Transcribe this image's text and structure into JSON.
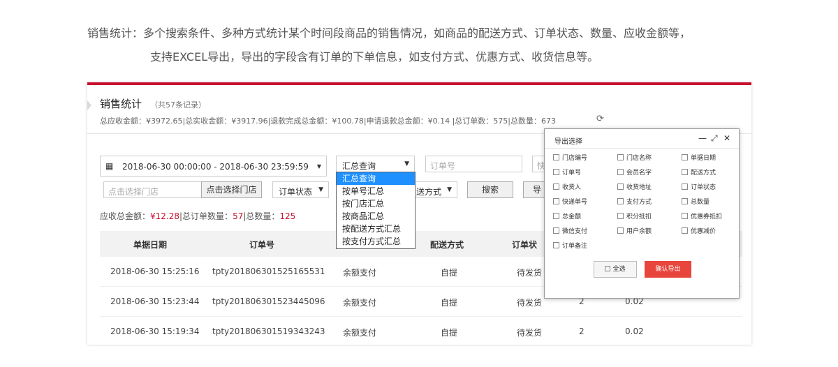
{
  "intro": {
    "line1": "销售统计：多个搜索条件、多种方式统计某个时间段商品的销售情况，如商品的配送方式、订单状态、数量、应收金额等，",
    "line2": "支持EXCEL导出，导出的字段含有订单的下单信息，如支付方式、优惠方式、收货信息等。"
  },
  "page": {
    "title": "销售统计",
    "record_count": "（共57条记录）",
    "summary": "总应收金额：¥3972.65|总实收金额：¥3917.96|退款完成总金额：¥100.78|申请退款总金额：¥0.14 |总订单数：575|总数量：673",
    "refresh_icon": "refresh-icon"
  },
  "filters": {
    "date_range": "2018-06-30 00:00:00 - 2018-06-30 23:59:59",
    "query_mode_value": "汇总查询",
    "order_no_placeholder": "订单号",
    "fast_placeholder": "快",
    "store_placeholder": "点击选择门店",
    "store_button": "点击选择门店",
    "order_status": "订单状态",
    "delivery_partial": "送方式",
    "search_button": "搜索",
    "export_partial": "导"
  },
  "query_modes": [
    "汇总查询",
    "按单号汇总",
    "按门店汇总",
    "按商品汇总",
    "按配送方式汇总",
    "按支付方式汇总"
  ],
  "totals": {
    "receivable_label": "应收总金额：",
    "receivable_value": "¥12.28",
    "orders_label": "|总订单数量：",
    "orders_value": "57",
    "qty_label": "|总数量：",
    "qty_value": "125"
  },
  "table": {
    "columns": [
      "单据日期",
      "订单号",
      "",
      "配送方式",
      "订单状"
    ],
    "rows": [
      {
        "date": "2018-06-30 15:25:16",
        "order": "tpty201806301525165531",
        "pay": "余额支付",
        "delivery": "自提",
        "status": "待发货",
        "qty": "",
        "amount": ""
      },
      {
        "date": "2018-06-30 15:23:44",
        "order": "tpty201806301523445096",
        "pay": "余额支付",
        "delivery": "自提",
        "status": "待发货",
        "qty": "2",
        "amount": "0.02"
      },
      {
        "date": "2018-06-30 15:19:34",
        "order": "tpty201806301519343243",
        "pay": "余额支付",
        "delivery": "自提",
        "status": "待发货",
        "qty": "2",
        "amount": "0.02"
      }
    ]
  },
  "export_dialog": {
    "title": "导出选择",
    "fields": [
      [
        "门店编号",
        "门店名称",
        "单据日期"
      ],
      [
        "订单号",
        "会员名字",
        "配送方式"
      ],
      [
        "收货人",
        "收货地址",
        "订单状态"
      ],
      [
        "快递单号",
        "支付方式",
        "总数量"
      ],
      [
        "总金额",
        "积分抵扣",
        "优惠券抵扣"
      ],
      [
        "微信支付",
        "用户余额",
        "优惠减价"
      ],
      [
        "订单备注",
        "",
        ""
      ]
    ],
    "select_all": "全选",
    "confirm": "确认导出"
  }
}
